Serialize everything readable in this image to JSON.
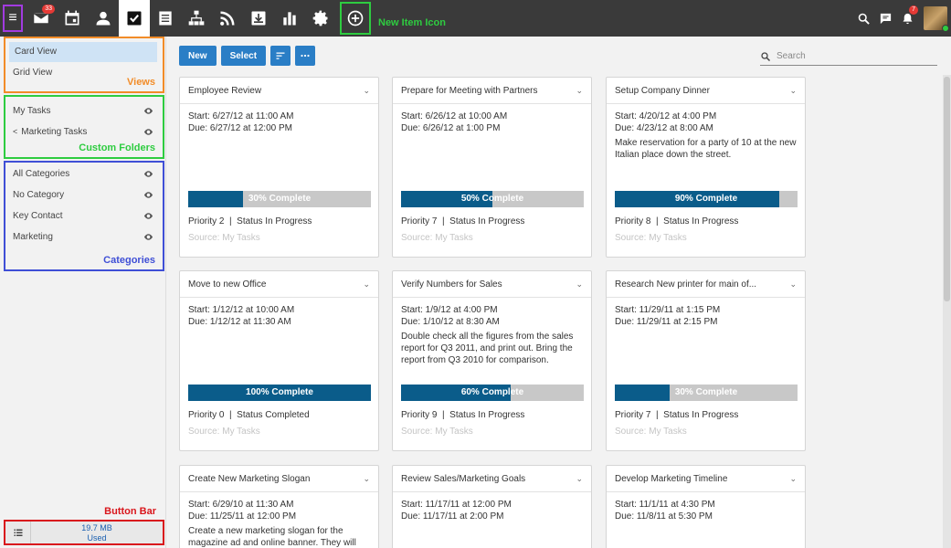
{
  "topbar": {
    "mail_badge": "33",
    "notif_badge": "7",
    "new_item_label": "New Item Icon"
  },
  "sidebar": {
    "views": [
      "Card View",
      "Grid View"
    ],
    "views_label": "Views",
    "folders": [
      "My Tasks",
      "Marketing Tasks"
    ],
    "folders_label": "Custom Folders",
    "categories": [
      "All Categories",
      "No Category",
      "Key Contact",
      "Marketing"
    ],
    "categories_label": "Categories",
    "button_bar_label": "Button Bar",
    "storage_size": "19.7 MB",
    "storage_used": "Used"
  },
  "toolbar": {
    "new_label": "New",
    "select_label": "Select"
  },
  "search": {
    "placeholder": "Search"
  },
  "cards": [
    {
      "title": "Employee Review",
      "start": "Start: 6/27/12 at 11:00 AM",
      "due": "Due: 6/27/12 at 12:00 PM",
      "desc": "",
      "progress": 30,
      "progress_label": "30% Complete",
      "priority": "Priority 2",
      "status": "Status In Progress",
      "source": "Source: My Tasks"
    },
    {
      "title": "Prepare for Meeting with Partners",
      "start": "Start: 6/26/12 at 10:00 AM",
      "due": "Due: 6/26/12 at 1:00 PM",
      "desc": "",
      "progress": 50,
      "progress_label": "50% Complete",
      "priority": "Priority 7",
      "status": "Status In Progress",
      "source": "Source: My Tasks"
    },
    {
      "title": "Setup Company Dinner",
      "start": "Start: 4/20/12 at 4:00 PM",
      "due": "Due: 4/23/12 at 8:00 AM",
      "desc": "Make reservation for a party of 10 at the new Italian place down the street.",
      "progress": 90,
      "progress_label": "90% Complete",
      "priority": "Priority 8",
      "status": "Status In Progress",
      "source": "Source: My Tasks"
    },
    {
      "title": "Move to new Office",
      "start": "Start: 1/12/12 at 10:00 AM",
      "due": "Due: 1/12/12 at 11:30 AM",
      "desc": "",
      "progress": 100,
      "progress_label": "100% Complete",
      "priority": "Priority 0",
      "status": "Status Completed",
      "source": "Source: My Tasks"
    },
    {
      "title": "Verify Numbers for Sales",
      "start": "Start: 1/9/12 at 4:00 PM",
      "due": "Due: 1/10/12 at 8:30 AM",
      "desc": "Double check all the figures from the sales report for Q3 2011, and print out. Bring the report from Q3 2010 for comparison.",
      "progress": 60,
      "progress_label": "60% Complete",
      "priority": "Priority 9",
      "status": "Status In Progress",
      "source": "Source: My Tasks"
    },
    {
      "title": "Research New printer for main of...",
      "start": "Start: 11/29/11 at 1:15 PM",
      "due": "Due: 11/29/11 at 2:15 PM",
      "desc": "",
      "progress": 30,
      "progress_label": "30% Complete",
      "priority": "Priority 7",
      "status": "Status In Progress",
      "source": "Source: My Tasks"
    },
    {
      "title": "Create New Marketing Slogan",
      "start": "Start: 6/29/10 at 11:30 AM",
      "due": "Due: 11/25/11 at 12:00 PM",
      "desc": "Create a new marketing slogan for the magazine ad and online banner. They will",
      "progress": null,
      "progress_label": "",
      "priority": "",
      "status": "",
      "source": ""
    },
    {
      "title": "Review Sales/Marketing Goals",
      "start": "Start: 11/17/11 at 12:00 PM",
      "due": "Due: 11/17/11 at 2:00 PM",
      "desc": "",
      "progress": null,
      "progress_label": "",
      "priority": "",
      "status": "",
      "source": ""
    },
    {
      "title": "Develop Marketing Timeline",
      "start": "Start: 11/1/11 at 4:30 PM",
      "due": "Due: 11/8/11 at 5:30 PM",
      "desc": "",
      "progress": null,
      "progress_label": "",
      "priority": "",
      "status": "",
      "source": ""
    }
  ]
}
